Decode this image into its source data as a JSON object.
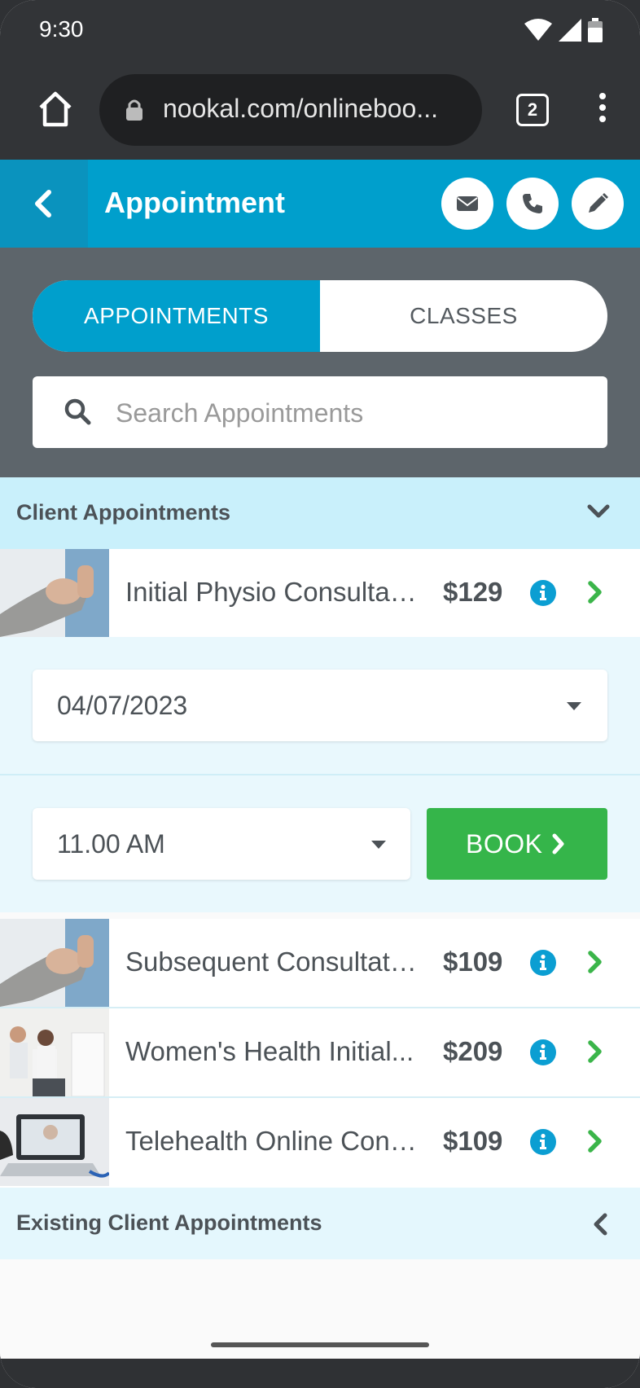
{
  "status": {
    "time": "9:30"
  },
  "browser": {
    "url": "nookal.com/onlineboo...",
    "tab_count": "2"
  },
  "header": {
    "title": "Appointment"
  },
  "segment": {
    "appointments": "APPOINTMENTS",
    "classes": "CLASSES",
    "active": "APPOINTMENTS"
  },
  "search": {
    "placeholder": "Search Appointments",
    "value": ""
  },
  "sections": {
    "client": "Client Appointments",
    "existing": "Existing Client Appointments"
  },
  "appointments": [
    {
      "title": "Initial Physio Consultati...",
      "price": "$129"
    },
    {
      "title": "Subsequent Consultatio...",
      "price": "$109"
    },
    {
      "title": "Women's Health Initial...",
      "price": "$209"
    },
    {
      "title": "Telehealth Online Cons...",
      "price": "$109"
    }
  ],
  "booking": {
    "date": "04/07/2023",
    "time": "11.00 AM",
    "book_label": "BOOK"
  },
  "colors": {
    "brand": "#009fcc",
    "book": "#35b54a",
    "section": "#c9f0fb"
  }
}
